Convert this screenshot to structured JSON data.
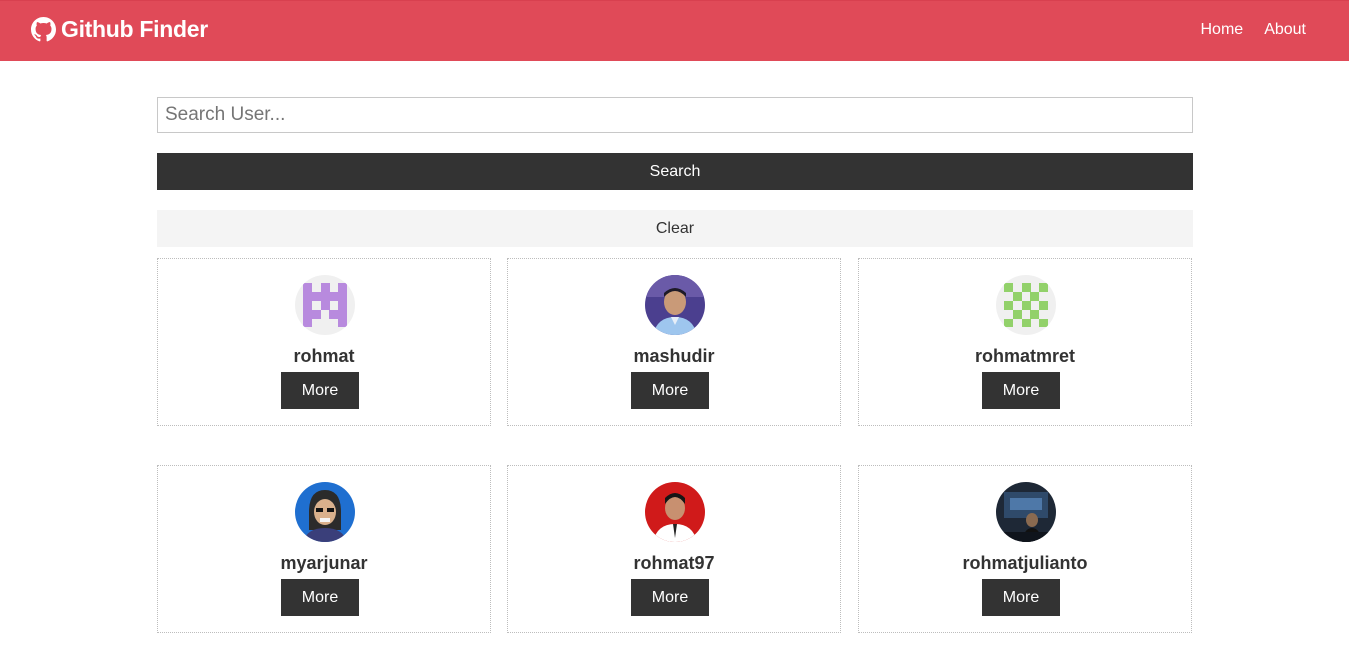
{
  "navbar": {
    "brand_icon": "github-icon",
    "brand_title": "Github Finder",
    "links": [
      "Home",
      "About"
    ]
  },
  "search": {
    "placeholder": "Search User...",
    "value": "",
    "search_label": "Search",
    "clear_label": "Clear"
  },
  "users": [
    {
      "login": "rohmat",
      "more_label": "More",
      "avatar": "identicon-purple"
    },
    {
      "login": "mashudir",
      "more_label": "More",
      "avatar": "photo-person-blue"
    },
    {
      "login": "rohmatmret",
      "more_label": "More",
      "avatar": "identicon-green"
    },
    {
      "login": "myarjunar",
      "more_label": "More",
      "avatar": "cartoon-person-blue"
    },
    {
      "login": "rohmat97",
      "more_label": "More",
      "avatar": "photo-person-red"
    },
    {
      "login": "rohmatjulianto",
      "more_label": "More",
      "avatar": "photo-person-dark"
    }
  ],
  "colors": {
    "navbar_bg": "#e04a58",
    "dark_button": "#333333",
    "light_button": "#f4f4f4"
  }
}
